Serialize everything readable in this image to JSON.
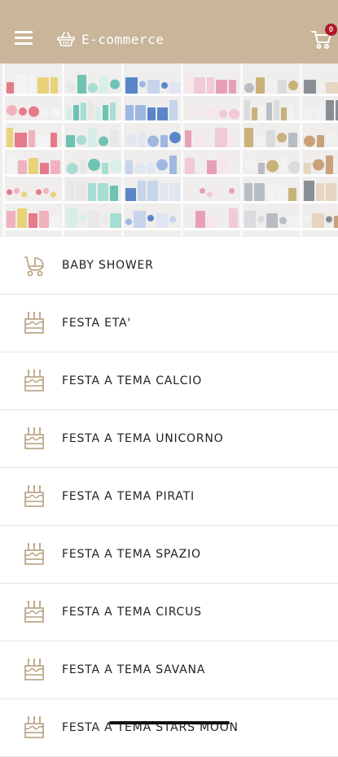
{
  "header": {
    "brand": "E-commerce",
    "cart_count": "0",
    "colors": {
      "bar": "#c8b59a",
      "badge": "#b3172a"
    },
    "icons": {
      "menu": "hamburger-menu-icon",
      "brand": "basket-icon",
      "cart": "cart-icon"
    }
  },
  "banner": {
    "image": "shop-shelves-photo"
  },
  "categories": [
    {
      "label": "BABY SHOWER",
      "icon": "stroller-icon"
    },
    {
      "label": "FESTA ETA'",
      "icon": "cake-icon"
    },
    {
      "label": "FESTA A TEMA CALCIO",
      "icon": "cake-icon"
    },
    {
      "label": "FESTA A TEMA UNICORNO",
      "icon": "cake-icon"
    },
    {
      "label": "FESTA A TEMA PIRATI",
      "icon": "cake-icon"
    },
    {
      "label": "FESTA A TEMA SPAZIO",
      "icon": "cake-icon"
    },
    {
      "label": "FESTA A TEMA CIRCUS",
      "icon": "cake-icon"
    },
    {
      "label": "FESTA A TEMA SAVANA",
      "icon": "cake-icon"
    },
    {
      "label": "FESTA A TEMA STARS MOON",
      "icon": "cake-icon"
    }
  ]
}
